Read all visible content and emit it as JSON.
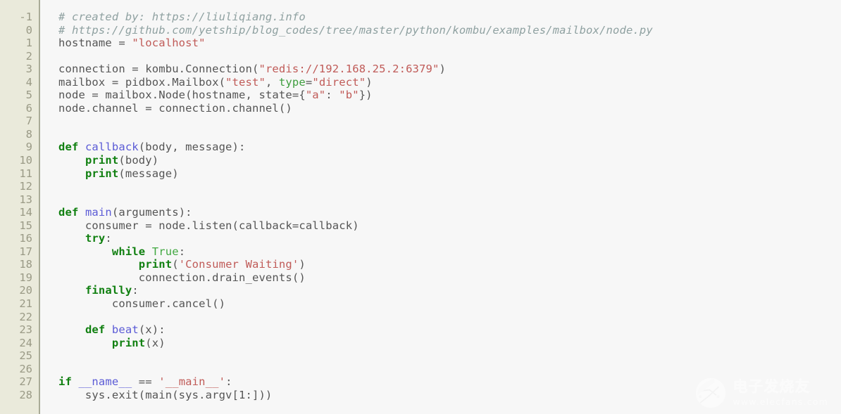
{
  "editor": {
    "language": "python",
    "background_color": "#f7f7f7",
    "gutter_background_color": "#eaeadb",
    "gutter_border_color": "#a9ab97",
    "line_number_color": "#9a9a86",
    "default_text_color": "#555555",
    "first_line_number": -1,
    "last_line_number": 28
  },
  "palette": {
    "comment": "#8fa1a1",
    "string": "#c05b58",
    "keyword": "#118011",
    "builtin": "#118011",
    "constant": "#41a841",
    "function_name": "#5b5bd6",
    "keyword_argument": "#3f9e3f",
    "magic_name": "#5b5bd6"
  },
  "line_numbers": [
    "-1",
    "0",
    "1",
    "2",
    "3",
    "4",
    "5",
    "6",
    "7",
    "8",
    "9",
    "10",
    "11",
    "12",
    "13",
    "14",
    "15",
    "16",
    "17",
    "18",
    "19",
    "20",
    "21",
    "22",
    "23",
    "24",
    "25",
    "26",
    "27",
    "28"
  ],
  "code_lines": [
    {
      "n": "-1",
      "tokens": [
        {
          "t": "# created by: https://liuliqiang.info",
          "c": "comment"
        }
      ]
    },
    {
      "n": "0",
      "tokens": [
        {
          "t": "# https://github.com/yetship/blog_codes/tree/master/python/kombu/examples/mailbox/node.py",
          "c": "comment"
        }
      ]
    },
    {
      "n": "1",
      "tokens": [
        {
          "t": "hostname = ",
          "c": "plain"
        },
        {
          "t": "\"localhost\"",
          "c": "string"
        }
      ]
    },
    {
      "n": "2",
      "tokens": []
    },
    {
      "n": "3",
      "tokens": [
        {
          "t": "connection = kombu.Connection(",
          "c": "plain"
        },
        {
          "t": "\"redis://192.168.25.2:6379\"",
          "c": "string"
        },
        {
          "t": ")",
          "c": "plain"
        }
      ]
    },
    {
      "n": "4",
      "tokens": [
        {
          "t": "mailbox = pidbox.Mailbox(",
          "c": "plain"
        },
        {
          "t": "\"test\"",
          "c": "string"
        },
        {
          "t": ", ",
          "c": "plain"
        },
        {
          "t": "type",
          "c": "kwarg"
        },
        {
          "t": "=",
          "c": "plain"
        },
        {
          "t": "\"direct\"",
          "c": "string"
        },
        {
          "t": ")",
          "c": "plain"
        }
      ]
    },
    {
      "n": "5",
      "tokens": [
        {
          "t": "node = mailbox.Node(hostname, state={",
          "c": "plain"
        },
        {
          "t": "\"a\"",
          "c": "string"
        },
        {
          "t": ": ",
          "c": "plain"
        },
        {
          "t": "\"b\"",
          "c": "string"
        },
        {
          "t": "})",
          "c": "plain"
        }
      ]
    },
    {
      "n": "6",
      "tokens": [
        {
          "t": "node.channel = connection.channel()",
          "c": "plain"
        }
      ]
    },
    {
      "n": "7",
      "tokens": []
    },
    {
      "n": "8",
      "tokens": []
    },
    {
      "n": "9",
      "tokens": [
        {
          "t": "def",
          "c": "keyword"
        },
        {
          "t": " ",
          "c": "plain"
        },
        {
          "t": "callback",
          "c": "funcname"
        },
        {
          "t": "(body, message):",
          "c": "plain"
        }
      ]
    },
    {
      "n": "10",
      "tokens": [
        {
          "t": "    ",
          "c": "plain"
        },
        {
          "t": "print",
          "c": "builtin"
        },
        {
          "t": "(body)",
          "c": "plain"
        }
      ]
    },
    {
      "n": "11",
      "tokens": [
        {
          "t": "    ",
          "c": "plain"
        },
        {
          "t": "print",
          "c": "builtin"
        },
        {
          "t": "(message)",
          "c": "plain"
        }
      ]
    },
    {
      "n": "12",
      "tokens": []
    },
    {
      "n": "13",
      "tokens": []
    },
    {
      "n": "14",
      "tokens": [
        {
          "t": "def",
          "c": "keyword"
        },
        {
          "t": " ",
          "c": "plain"
        },
        {
          "t": "main",
          "c": "funcname"
        },
        {
          "t": "(arguments):",
          "c": "plain"
        }
      ]
    },
    {
      "n": "15",
      "tokens": [
        {
          "t": "    consumer = node.listen(callback=callback)",
          "c": "plain"
        }
      ]
    },
    {
      "n": "16",
      "tokens": [
        {
          "t": "    ",
          "c": "plain"
        },
        {
          "t": "try",
          "c": "keyword"
        },
        {
          "t": ":",
          "c": "plain"
        }
      ]
    },
    {
      "n": "17",
      "tokens": [
        {
          "t": "        ",
          "c": "plain"
        },
        {
          "t": "while",
          "c": "keyword"
        },
        {
          "t": " ",
          "c": "plain"
        },
        {
          "t": "True",
          "c": "const"
        },
        {
          "t": ":",
          "c": "plain"
        }
      ]
    },
    {
      "n": "18",
      "tokens": [
        {
          "t": "            ",
          "c": "plain"
        },
        {
          "t": "print",
          "c": "builtin"
        },
        {
          "t": "(",
          "c": "plain"
        },
        {
          "t": "'Consumer Waiting'",
          "c": "string"
        },
        {
          "t": ")",
          "c": "plain"
        }
      ]
    },
    {
      "n": "19",
      "tokens": [
        {
          "t": "            connection.drain_events()",
          "c": "plain"
        }
      ]
    },
    {
      "n": "20",
      "tokens": [
        {
          "t": "    ",
          "c": "plain"
        },
        {
          "t": "finally",
          "c": "keyword"
        },
        {
          "t": ":",
          "c": "plain"
        }
      ]
    },
    {
      "n": "21",
      "tokens": [
        {
          "t": "        consumer.cancel()",
          "c": "plain"
        }
      ]
    },
    {
      "n": "22",
      "tokens": []
    },
    {
      "n": "23",
      "tokens": [
        {
          "t": "    ",
          "c": "plain"
        },
        {
          "t": "def",
          "c": "keyword"
        },
        {
          "t": " ",
          "c": "plain"
        },
        {
          "t": "beat",
          "c": "funcname"
        },
        {
          "t": "(x):",
          "c": "plain"
        }
      ]
    },
    {
      "n": "24",
      "tokens": [
        {
          "t": "        ",
          "c": "plain"
        },
        {
          "t": "print",
          "c": "builtin"
        },
        {
          "t": "(x)",
          "c": "plain"
        }
      ]
    },
    {
      "n": "25",
      "tokens": []
    },
    {
      "n": "26",
      "tokens": []
    },
    {
      "n": "27",
      "tokens": [
        {
          "t": "if",
          "c": "keyword"
        },
        {
          "t": " ",
          "c": "plain"
        },
        {
          "t": "__name__",
          "c": "magic"
        },
        {
          "t": " == ",
          "c": "plain"
        },
        {
          "t": "'__main__'",
          "c": "string"
        },
        {
          "t": ":",
          "c": "plain"
        }
      ]
    },
    {
      "n": "28",
      "tokens": [
        {
          "t": "    sys.exit(main(sys.argv[1:]))",
          "c": "plain"
        }
      ]
    }
  ],
  "watermark": {
    "logo_icon": "circuit-circle-logo-icon",
    "brand_cn": "电子发烧友",
    "brand_url": "www.elecfans.com"
  }
}
